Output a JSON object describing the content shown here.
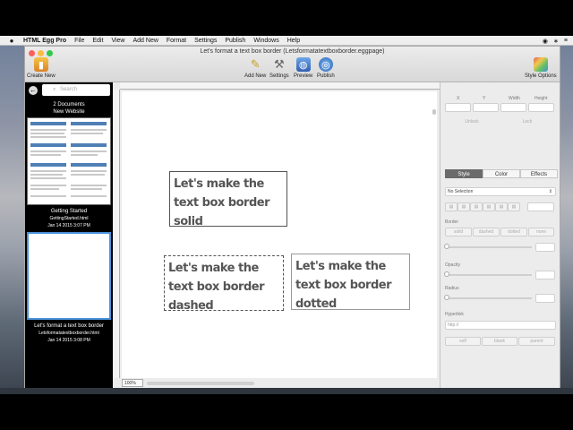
{
  "menubar": {
    "apple": "",
    "app_name": "HTML Egg Pro",
    "menus": [
      "File",
      "Edit",
      "View",
      "Add New",
      "Format",
      "Settings",
      "Publish",
      "Windows",
      "Help"
    ],
    "status_icons": [
      "◉",
      "∗",
      "≡"
    ]
  },
  "window": {
    "title": "Let's format a text box border (Letsformatatextboxborder.eggpage)",
    "toolbar": {
      "create_new": "Create New",
      "add_new": "Add New",
      "settings": "Settings",
      "preview": "Preview",
      "publish": "Publish",
      "style_options": "Style Options"
    }
  },
  "sidebar": {
    "search_placeholder": "Search",
    "doc_count": "2 Documents",
    "website_name": "New Website",
    "documents": [
      {
        "title": "Getting Started",
        "file": "GettingStarted.html",
        "date": "Jan 14 2015 3:07 PM"
      },
      {
        "title": "Let's format a text box border",
        "file": "Letsformatatextboxborder.html",
        "date": "Jan 14 2015 3:08 PM"
      }
    ]
  },
  "canvas": {
    "zoom": "100%",
    "textboxes": [
      {
        "text": "Let's make the text box border solid"
      },
      {
        "text": "Let's make the text box border dashed"
      },
      {
        "text": "Let's make the text box border dotted"
      }
    ]
  },
  "inspector": {
    "x_label": "X",
    "y_label": "Y",
    "width_label": "Width",
    "height_label": "Height",
    "unlock": "Unlock",
    "lock": "Lock",
    "tabs": [
      "Style",
      "Color",
      "Effects"
    ],
    "selection": "No Selection",
    "border_label": "Border",
    "border_styles": [
      "solid",
      "dashed",
      "dotted",
      "none"
    ],
    "opacity_label": "Opacity",
    "radius_label": "Radius",
    "hyperlink_label": "Hyperlink",
    "hyperlink_placeholder": "http://",
    "targets": [
      "self",
      "blank",
      "parent"
    ]
  }
}
